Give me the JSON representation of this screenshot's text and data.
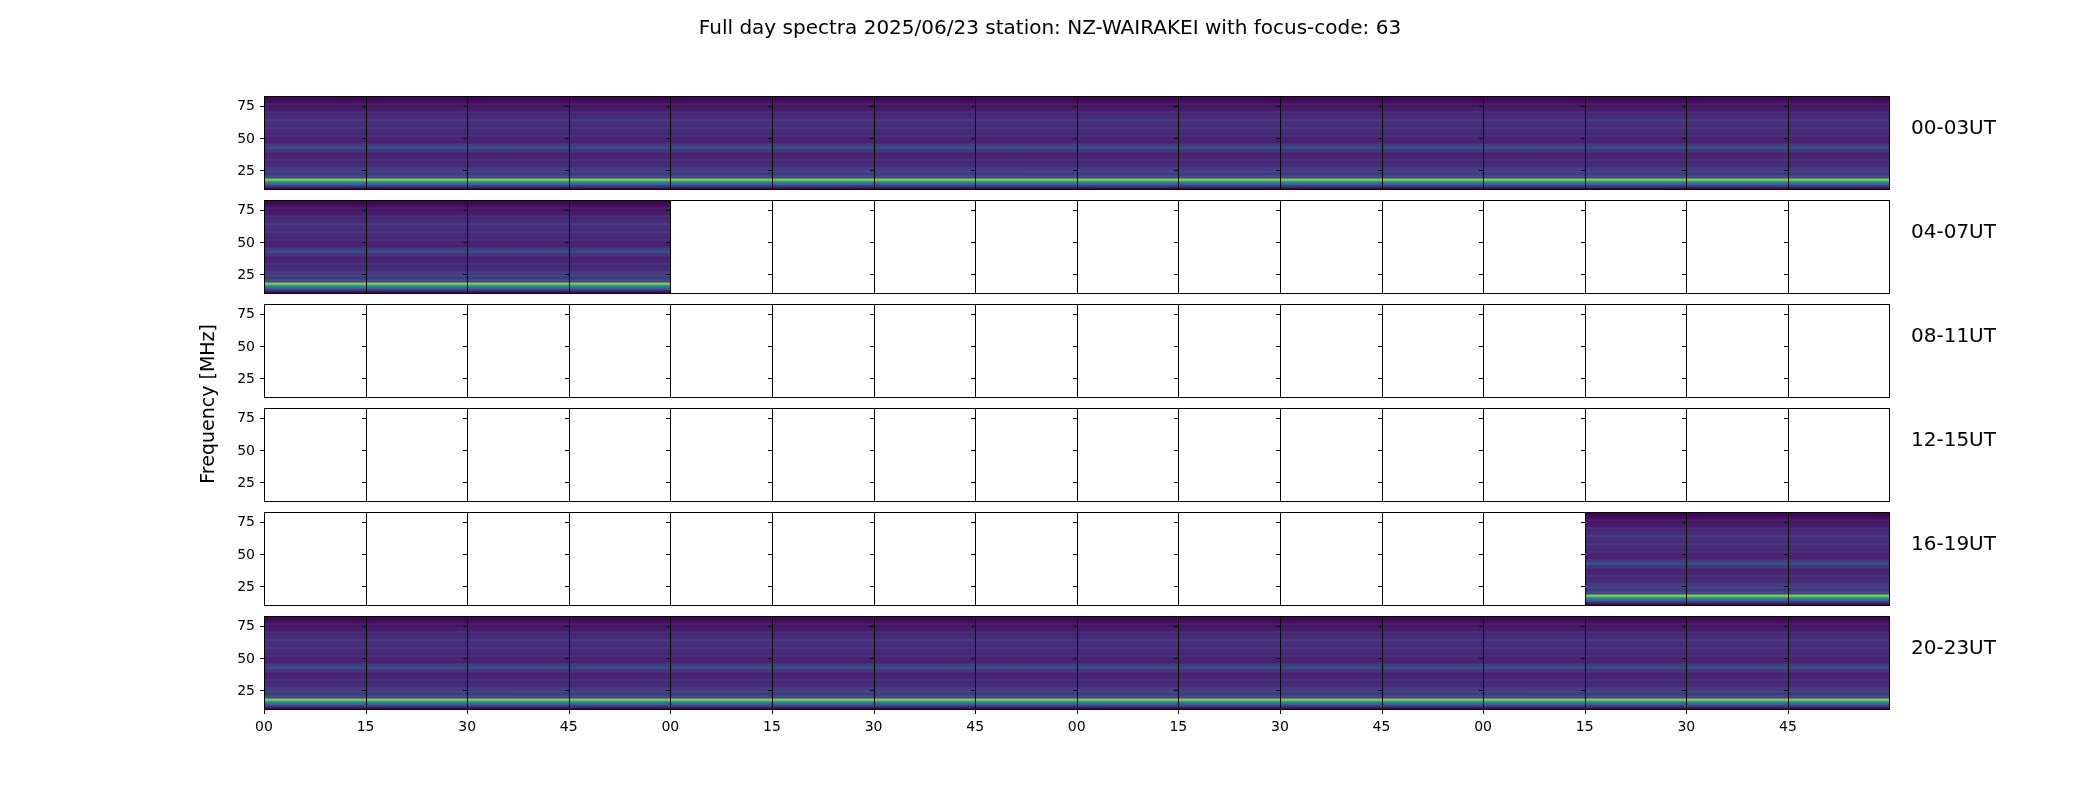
{
  "title": "Full day spectra 2025/06/23 station: NZ-WAIRAKEI with focus-code: 63",
  "ylabel": "Frequency [MHz]",
  "xticks": [
    "00",
    "15",
    "30",
    "45",
    "00",
    "15",
    "30",
    "45",
    "00",
    "15",
    "30",
    "45",
    "00",
    "15",
    "30",
    "45"
  ],
  "rows": [
    {
      "label": "00-03UT",
      "yticks": [
        "75",
        "50",
        "25"
      ],
      "panels": [
        true,
        true,
        true,
        true,
        true,
        true,
        true,
        true,
        true,
        true,
        true,
        true,
        true,
        true,
        true,
        true
      ]
    },
    {
      "label": "04-07UT",
      "yticks": [
        "75",
        "50",
        "25"
      ],
      "panels": [
        true,
        true,
        true,
        true,
        false,
        false,
        false,
        false,
        false,
        false,
        false,
        false,
        false,
        false,
        false,
        false
      ]
    },
    {
      "label": "08-11UT",
      "yticks": [
        "75",
        "50",
        "25"
      ],
      "panels": [
        false,
        false,
        false,
        false,
        false,
        false,
        false,
        false,
        false,
        false,
        false,
        false,
        false,
        false,
        false,
        false
      ]
    },
    {
      "label": "12-15UT",
      "yticks": [
        "75",
        "50",
        "25"
      ],
      "panels": [
        false,
        false,
        false,
        false,
        false,
        false,
        false,
        false,
        false,
        false,
        false,
        false,
        false,
        false,
        false,
        false
      ]
    },
    {
      "label": "16-19UT",
      "yticks": [
        "75",
        "50",
        "25"
      ],
      "panels": [
        false,
        false,
        false,
        false,
        false,
        false,
        false,
        false,
        false,
        false,
        false,
        false,
        false,
        true,
        true,
        true
      ]
    },
    {
      "label": "20-23UT",
      "yticks": [
        "75",
        "50",
        "25"
      ],
      "panels": [
        true,
        true,
        true,
        true,
        true,
        true,
        true,
        true,
        true,
        true,
        true,
        true,
        true,
        true,
        true,
        true
      ]
    }
  ]
}
